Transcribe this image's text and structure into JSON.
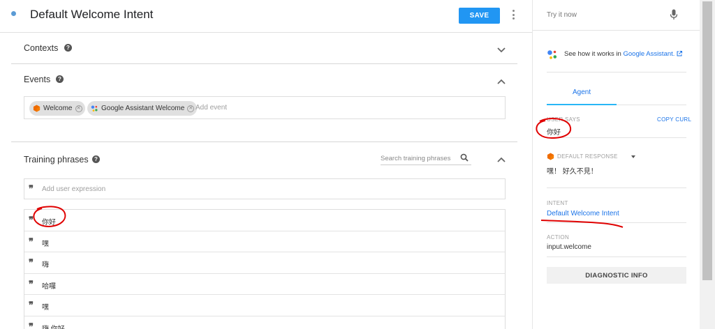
{
  "header": {
    "title": "Default Welcome Intent",
    "save_label": "SAVE"
  },
  "contexts": {
    "title": "Contexts"
  },
  "events": {
    "title": "Events",
    "chips": [
      {
        "label": "Welcome",
        "icon": "dialogflow-icon"
      },
      {
        "label": "Google Assistant Welcome",
        "icon": "google-assistant-icon"
      }
    ],
    "add_placeholder": "Add event"
  },
  "training": {
    "title": "Training phrases",
    "search_placeholder": "Search training phrases",
    "add_placeholder": "Add user expression",
    "phrases": [
      "你好",
      "嘿",
      "嗨",
      "哈囉",
      "嘿",
      "嗨 你好"
    ]
  },
  "try_panel": {
    "try_placeholder": "Try it now",
    "see_how_prefix": "See how it works in ",
    "see_how_link": "Google Assistant.",
    "tab_agent": "Agent",
    "user_says_label": "USER SAYS",
    "copy_curl": "COPY CURL",
    "user_says_value": "你好",
    "default_response_label": "DEFAULT RESPONSE",
    "default_response_value": "嘿！ 好久不見！",
    "intent_label": "INTENT",
    "intent_value": "Default Welcome Intent",
    "action_label": "ACTION",
    "action_value": "input.welcome",
    "diagnostic_label": "DIAGNOSTIC INFO"
  },
  "colors": {
    "primary": "#2196f3",
    "link": "#1a73e8",
    "annotation": "#e00000",
    "dialogflow_orange": "#ef6c00"
  }
}
